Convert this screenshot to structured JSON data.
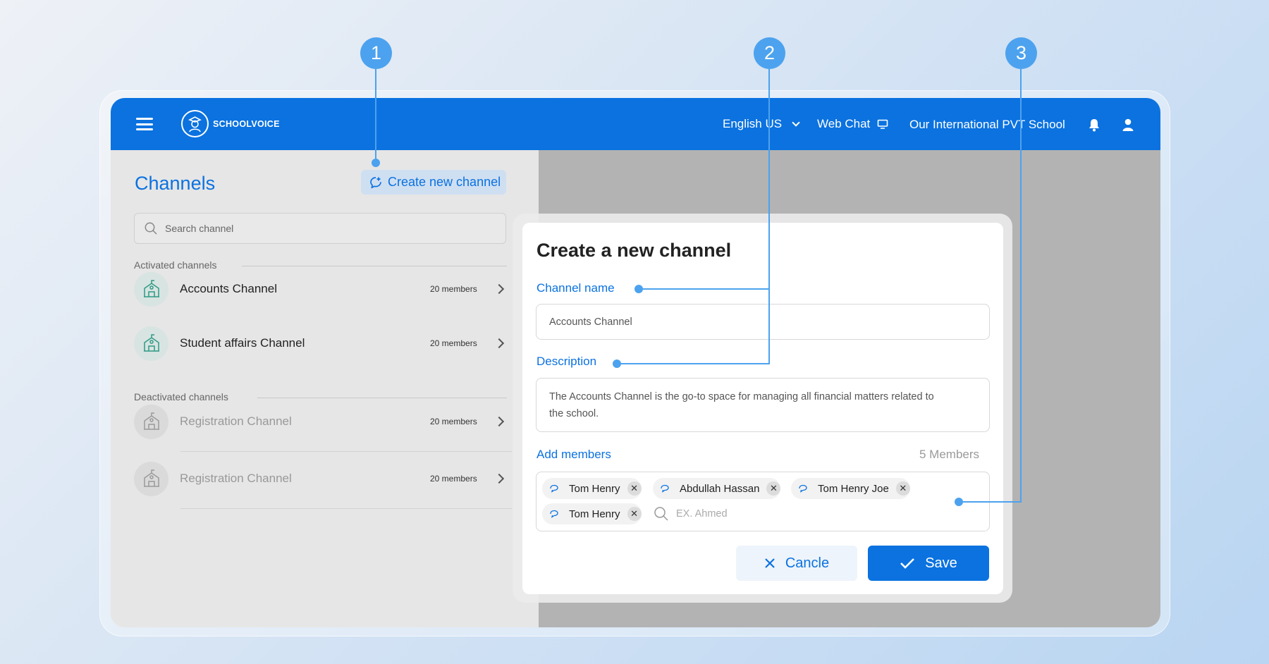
{
  "app": {
    "brand": "SCHOOLVOICE",
    "language": "English US",
    "web_chat": "Web Chat",
    "school": "Our International PVT School"
  },
  "sidebar": {
    "title": "Channels",
    "create_button": "Create new channel",
    "search_placeholder": "Search channel",
    "activated_label": "Activated channels",
    "deactivated_label": "Deactivated channels",
    "activated": [
      {
        "name": "Accounts Channel",
        "members": "20 members"
      },
      {
        "name": "Student affairs Channel",
        "members": "20 members"
      }
    ],
    "deactivated": [
      {
        "name": "Registration Channel",
        "members": "20 members"
      },
      {
        "name": "Registration Channel",
        "members": "20 members"
      }
    ]
  },
  "modal": {
    "title": "Create a new channel",
    "channel_name_label": "Channel name",
    "channel_name_value": "Accounts Channel",
    "description_label": "Description",
    "description_line1": "The Accounts Channel is the go-to space for managing all financial matters related to",
    "description_line2": "the school.",
    "add_members_label": "Add members",
    "members_count": "5 Members",
    "members": [
      "Tom Henry",
      "Abdullah Hassan",
      "Tom Henry Joe",
      "Tom Henry"
    ],
    "member_search_placeholder": "EX. Ahmed",
    "cancel_label": "Cancle",
    "save_label": "Save"
  },
  "annotations": [
    "1",
    "2",
    "3"
  ],
  "colors": {
    "primary": "#0b72e0",
    "annotation": "#4ca2ee",
    "active_icon": "#2e9a86"
  }
}
